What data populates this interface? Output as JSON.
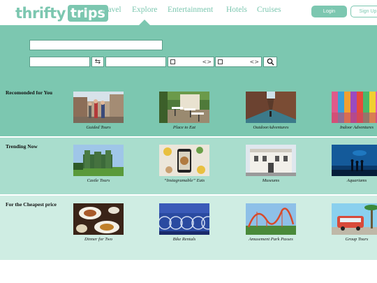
{
  "logo": {
    "word": "thrifty",
    "box": "trips"
  },
  "nav": {
    "items": [
      "Travel",
      "Explore",
      "Entertainment",
      "Hotels",
      "Cruises"
    ],
    "active": "Explore"
  },
  "auth": {
    "login": "Login",
    "signup": "Sign Up"
  },
  "search": {
    "query": "",
    "from": "",
    "to": "",
    "swap_icon": "swap-arrows-icon",
    "search_icon": "magnifier-icon"
  },
  "sections": [
    {
      "title": "Recomonded for You",
      "cards": [
        "Guided Tours",
        "Place to Eat",
        "OutdoorAdventures",
        "Indoor Adventures"
      ]
    },
    {
      "title": "Trending Now",
      "cards": [
        "Castle Tours",
        "“Instagramable” Eats",
        "Museums",
        "Aquariams"
      ]
    },
    {
      "title": "For the Cheapest price",
      "cards": [
        "Dinner for Two",
        "Bike Rentals",
        "Amusement Park Passes",
        "Group Tours"
      ]
    }
  ],
  "colors": {
    "accent": "#7cc7b0",
    "band2": "#a9ddcd",
    "band3": "#cfede3"
  }
}
